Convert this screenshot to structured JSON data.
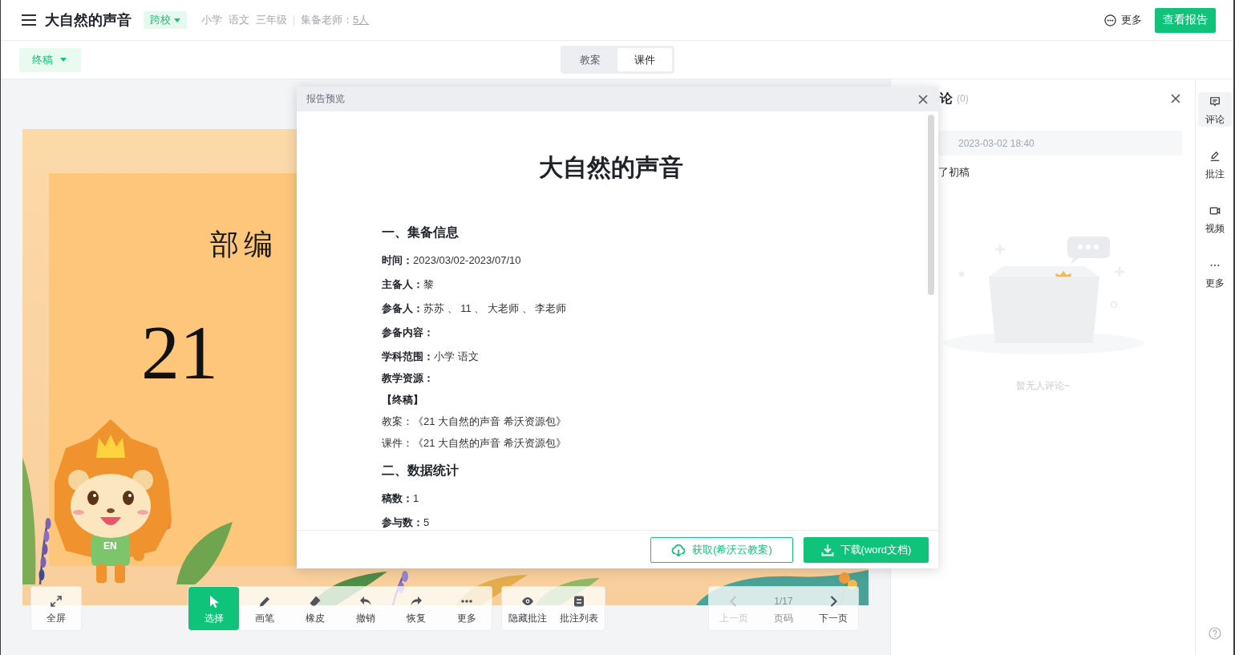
{
  "header": {
    "title": "大自然的声音",
    "scope": "跨校",
    "subjects": [
      "小学",
      "语文",
      "三年级"
    ],
    "teachers_label": "集备老师：",
    "teachers_count": "5人",
    "more": "更多",
    "report_button": "查看报告"
  },
  "subbar": {
    "version": "终稿",
    "tabs": [
      {
        "label": "教案",
        "selected": false
      },
      {
        "label": "课件",
        "selected": true
      }
    ]
  },
  "slide": {
    "subtitle": "部编",
    "title": "21",
    "mascot_shirt": "EN"
  },
  "toolbar": {
    "fullscreen": "全屏",
    "tools": [
      {
        "kind": "select",
        "label": "选择",
        "selected": true
      },
      {
        "kind": "pen",
        "label": "画笔",
        "selected": false
      },
      {
        "kind": "eraser",
        "label": "橡皮",
        "selected": false
      },
      {
        "kind": "undo",
        "label": "撤销",
        "selected": false
      },
      {
        "kind": "redo",
        "label": "恢复",
        "selected": false
      },
      {
        "kind": "more",
        "label": "更多",
        "selected": false
      }
    ],
    "annotations": [
      {
        "kind": "hide",
        "label": "隐藏批注"
      },
      {
        "kind": "list",
        "label": "批注列表"
      }
    ],
    "pager": {
      "prev": {
        "label": "上一页",
        "disabled": true
      },
      "page": "1/17",
      "page_label": "页码",
      "next": {
        "label": "下一页",
        "disabled": false
      }
    }
  },
  "report_dialog": {
    "title": "报告预览",
    "doc_title": "大自然的声音",
    "sections": [
      {
        "heading": "一、集备信息",
        "lines": [
          {
            "kind": "field",
            "label": "时间：",
            "value": "2023/03/02-2023/07/10"
          },
          {
            "kind": "field",
            "label": "主备人：",
            "value": "黎"
          },
          {
            "kind": "field",
            "label": "参备人：",
            "value": "苏苏 、 11 、 大老师 、 李老师"
          },
          {
            "kind": "field",
            "label": "参备内容："
          },
          {
            "kind": "field",
            "label": "学科范围：",
            "value": "小学 语文"
          },
          {
            "kind": "label",
            "label": "教学资源："
          },
          {
            "kind": "group",
            "label": "【终稿】"
          },
          {
            "kind": "resource",
            "label": "教案：",
            "value": "《21 大自然的声音 希沃资源包》"
          },
          {
            "kind": "resource",
            "label": "课件：",
            "value": "《21 大自然的声音 希沃资源包》"
          }
        ]
      },
      {
        "heading": "二、数据统计",
        "lines": [
          {
            "kind": "field",
            "label": "稿数：",
            "value": "1"
          },
          {
            "kind": "field",
            "label": "参与数：",
            "value": "5"
          }
        ]
      }
    ],
    "buttons": [
      {
        "kind": "outline",
        "label": "获取(希沃云教案)"
      },
      {
        "kind": "primary",
        "label": "下载(word文档)"
      }
    ]
  },
  "comments_panel": {
    "title": "论",
    "count": "(0)",
    "comments": [
      {
        "time": "2023-03-02 18:40",
        "text": "了初稿"
      }
    ],
    "empty_text": "暂无人评论~"
  },
  "side_rail": {
    "items": [
      {
        "kind": "comment",
        "label": "评论",
        "selected": true
      },
      {
        "kind": "annotate",
        "label": "批注",
        "selected": false
      },
      {
        "kind": "video",
        "label": "视频",
        "selected": false
      },
      {
        "kind": "more",
        "label": "更多",
        "selected": false
      }
    ]
  }
}
